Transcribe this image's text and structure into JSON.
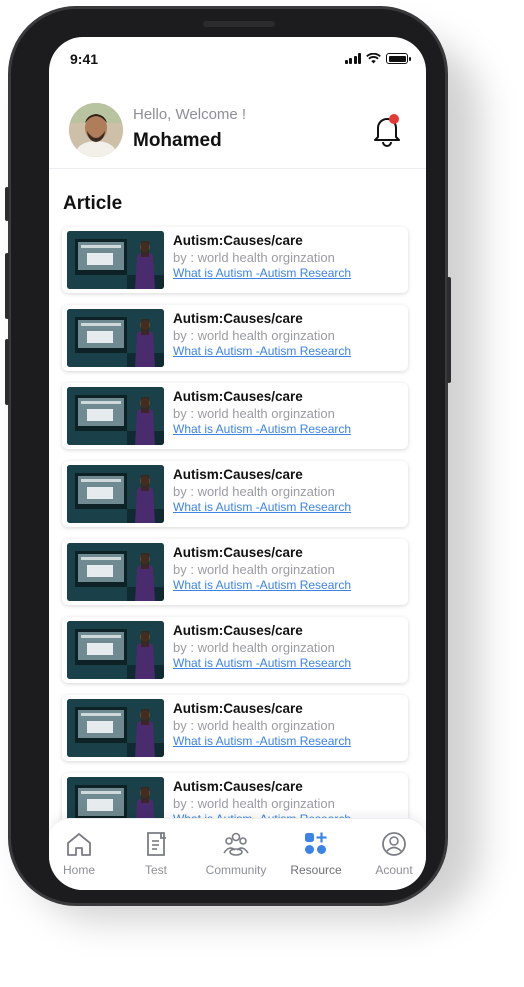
{
  "status_bar": {
    "time": "9:41"
  },
  "header": {
    "greeting": "Hello, Welcome !",
    "username": "Mohamed"
  },
  "section_title": "Article",
  "articles": [
    {
      "title": "Autism:Causes/care",
      "author": "by : world health orginzation",
      "link": "What is Autism -Autism Research"
    },
    {
      "title": "Autism:Causes/care",
      "author": "by : world health orginzation",
      "link": "What is Autism -Autism Research"
    },
    {
      "title": "Autism:Causes/care",
      "author": "by : world health orginzation",
      "link": "What is Autism -Autism Research"
    },
    {
      "title": "Autism:Causes/care",
      "author": "by : world health orginzation",
      "link": "What is Autism -Autism Research"
    },
    {
      "title": "Autism:Causes/care",
      "author": "by : world health orginzation",
      "link": "What is Autism -Autism Research"
    },
    {
      "title": "Autism:Causes/care",
      "author": "by : world health orginzation",
      "link": "What is Autism -Autism Research"
    },
    {
      "title": "Autism:Causes/care",
      "author": "by : world health orginzation",
      "link": "What is Autism -Autism Research"
    },
    {
      "title": "Autism:Causes/care",
      "author": "by : world health orginzation",
      "link": "What is Autism -Autism Research"
    }
  ],
  "nav": {
    "items": [
      {
        "label": "Home",
        "icon": "home-icon"
      },
      {
        "label": "Test",
        "icon": "test-icon"
      },
      {
        "label": "Community",
        "icon": "community-icon"
      },
      {
        "label": "Resource",
        "icon": "resource-icon",
        "active": true
      },
      {
        "label": "Acount",
        "icon": "account-icon"
      }
    ]
  },
  "colors": {
    "accent": "#3c83e6",
    "notification_dot": "#e53935",
    "muted_text": "#8c8f96"
  }
}
